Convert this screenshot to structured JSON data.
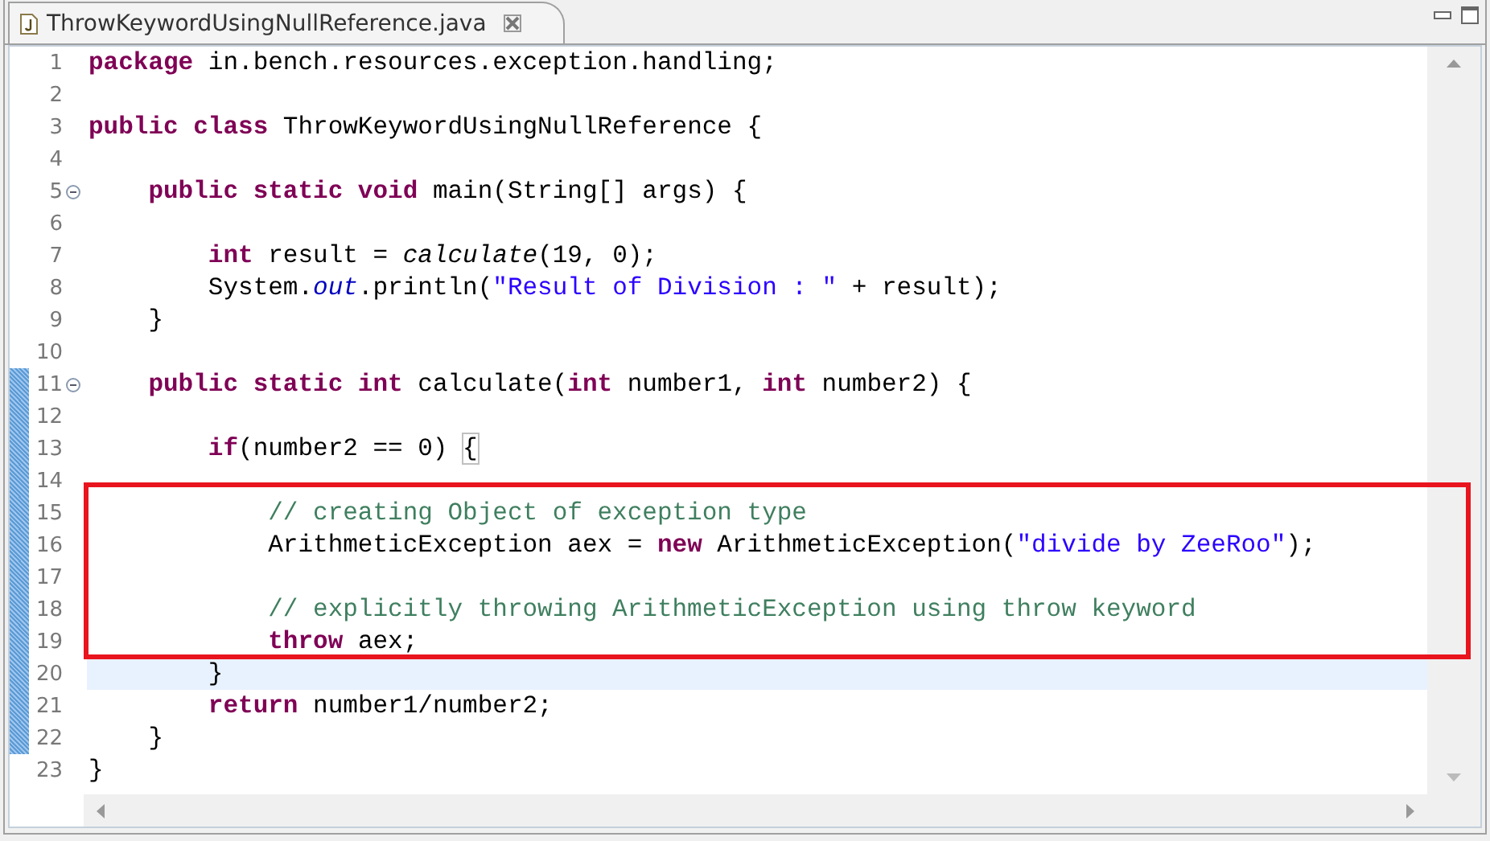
{
  "tab": {
    "title": "ThrowKeywordUsingNullReference.java",
    "selected": true
  },
  "lines": [
    {
      "number": "1",
      "foldable": false,
      "changed": false,
      "current": false,
      "highlighted": false,
      "tokens": [
        {
          "kind": "keyword",
          "text": "package"
        },
        {
          "kind": "plain",
          "text": " in.bench.resources.exception.handling;"
        }
      ]
    },
    {
      "number": "2",
      "foldable": false,
      "changed": false,
      "current": false,
      "highlighted": false
    },
    {
      "number": "3",
      "foldable": false,
      "changed": false,
      "current": false,
      "highlighted": false,
      "tokens": [
        {
          "kind": "keyword",
          "text": "public class"
        },
        {
          "kind": "plain",
          "text": " ThrowKeywordUsingNullReference {"
        }
      ]
    },
    {
      "number": "4",
      "foldable": false,
      "changed": false,
      "current": false,
      "highlighted": false
    },
    {
      "number": "5",
      "foldable": true,
      "changed": false,
      "current": false,
      "highlighted": false,
      "tokens": [
        {
          "kind": "keyword",
          "text": "    public static void"
        },
        {
          "kind": "plain",
          "text": " main(String[] args) {"
        }
      ]
    },
    {
      "number": "6",
      "foldable": false,
      "changed": false,
      "current": false,
      "highlighted": false
    },
    {
      "number": "7",
      "foldable": false,
      "changed": false,
      "current": false,
      "highlighted": false,
      "tokens": [
        {
          "kind": "keyword",
          "text": "        int"
        },
        {
          "kind": "plain",
          "text": " result = "
        },
        {
          "kind": "method",
          "text": "calculate"
        },
        {
          "kind": "plain",
          "text": "(19, 0);"
        }
      ]
    },
    {
      "number": "8",
      "foldable": false,
      "changed": false,
      "current": false,
      "highlighted": false,
      "tokens": [
        {
          "kind": "plain",
          "text": "        System."
        },
        {
          "kind": "field",
          "text": "out"
        },
        {
          "kind": "plain",
          "text": ".println("
        },
        {
          "kind": "string",
          "text": "\"Result of Division : \""
        },
        {
          "kind": "plain",
          "text": " + result);"
        }
      ]
    },
    {
      "number": "9",
      "foldable": false,
      "changed": false,
      "current": false,
      "highlighted": false,
      "tokens": [
        {
          "kind": "plain",
          "text": "    }"
        }
      ]
    },
    {
      "number": "10",
      "foldable": false,
      "changed": false,
      "current": false,
      "highlighted": false
    },
    {
      "number": "11",
      "foldable": true,
      "changed": true,
      "current": false,
      "highlighted": false,
      "tokens": [
        {
          "kind": "keyword",
          "text": "    public static int"
        },
        {
          "kind": "plain",
          "text": " calculate("
        },
        {
          "kind": "keyword",
          "text": "int"
        },
        {
          "kind": "plain",
          "text": " number1, "
        },
        {
          "kind": "keyword",
          "text": "int"
        },
        {
          "kind": "plain",
          "text": " number2) {"
        }
      ]
    },
    {
      "number": "12",
      "foldable": false,
      "changed": true,
      "current": false,
      "highlighted": false
    },
    {
      "number": "13",
      "foldable": false,
      "changed": true,
      "current": false,
      "highlighted": false,
      "tokens": [
        {
          "kind": "keyword",
          "text": "        if"
        },
        {
          "kind": "plain",
          "text": "(number2 == 0) "
        },
        {
          "kind": "bracket-match",
          "text": "{"
        }
      ]
    },
    {
      "number": "14",
      "foldable": false,
      "changed": true,
      "current": false,
      "highlighted": false
    },
    {
      "number": "15",
      "foldable": false,
      "changed": true,
      "current": false,
      "highlighted": true,
      "tokens": [
        {
          "kind": "comment",
          "text": "            // creating Object of exception type"
        }
      ]
    },
    {
      "number": "16",
      "foldable": false,
      "changed": true,
      "current": false,
      "highlighted": true,
      "tokens": [
        {
          "kind": "plain",
          "text": "            ArithmeticException aex = "
        },
        {
          "kind": "keyword",
          "text": "new"
        },
        {
          "kind": "plain",
          "text": " ArithmeticException("
        },
        {
          "kind": "string",
          "text": "\"divide by ZeeRoo\""
        },
        {
          "kind": "plain",
          "text": ");"
        }
      ]
    },
    {
      "number": "17",
      "foldable": false,
      "changed": true,
      "current": false,
      "highlighted": true
    },
    {
      "number": "18",
      "foldable": false,
      "changed": true,
      "current": false,
      "highlighted": true,
      "tokens": [
        {
          "kind": "comment",
          "text": "            // explicitly throwing ArithmeticException using throw keyword"
        }
      ]
    },
    {
      "number": "19",
      "foldable": false,
      "changed": true,
      "current": false,
      "highlighted": true,
      "tokens": [
        {
          "kind": "keyword",
          "text": "            throw"
        },
        {
          "kind": "plain",
          "text": " aex;"
        }
      ]
    },
    {
      "number": "20",
      "foldable": false,
      "changed": true,
      "current": true,
      "highlighted": false,
      "tokens": [
        {
          "kind": "plain",
          "text": "        }"
        }
      ]
    },
    {
      "number": "21",
      "foldable": false,
      "changed": true,
      "current": false,
      "highlighted": false,
      "tokens": [
        {
          "kind": "keyword",
          "text": "        return"
        },
        {
          "kind": "plain",
          "text": " number1/number2;"
        }
      ]
    },
    {
      "number": "22",
      "foldable": false,
      "changed": true,
      "current": false,
      "highlighted": false,
      "tokens": [
        {
          "kind": "plain",
          "text": "    }"
        }
      ]
    },
    {
      "number": "23",
      "foldable": false,
      "changed": false,
      "current": false,
      "highlighted": false,
      "tokens": [
        {
          "kind": "plain",
          "text": "}"
        }
      ]
    }
  ]
}
